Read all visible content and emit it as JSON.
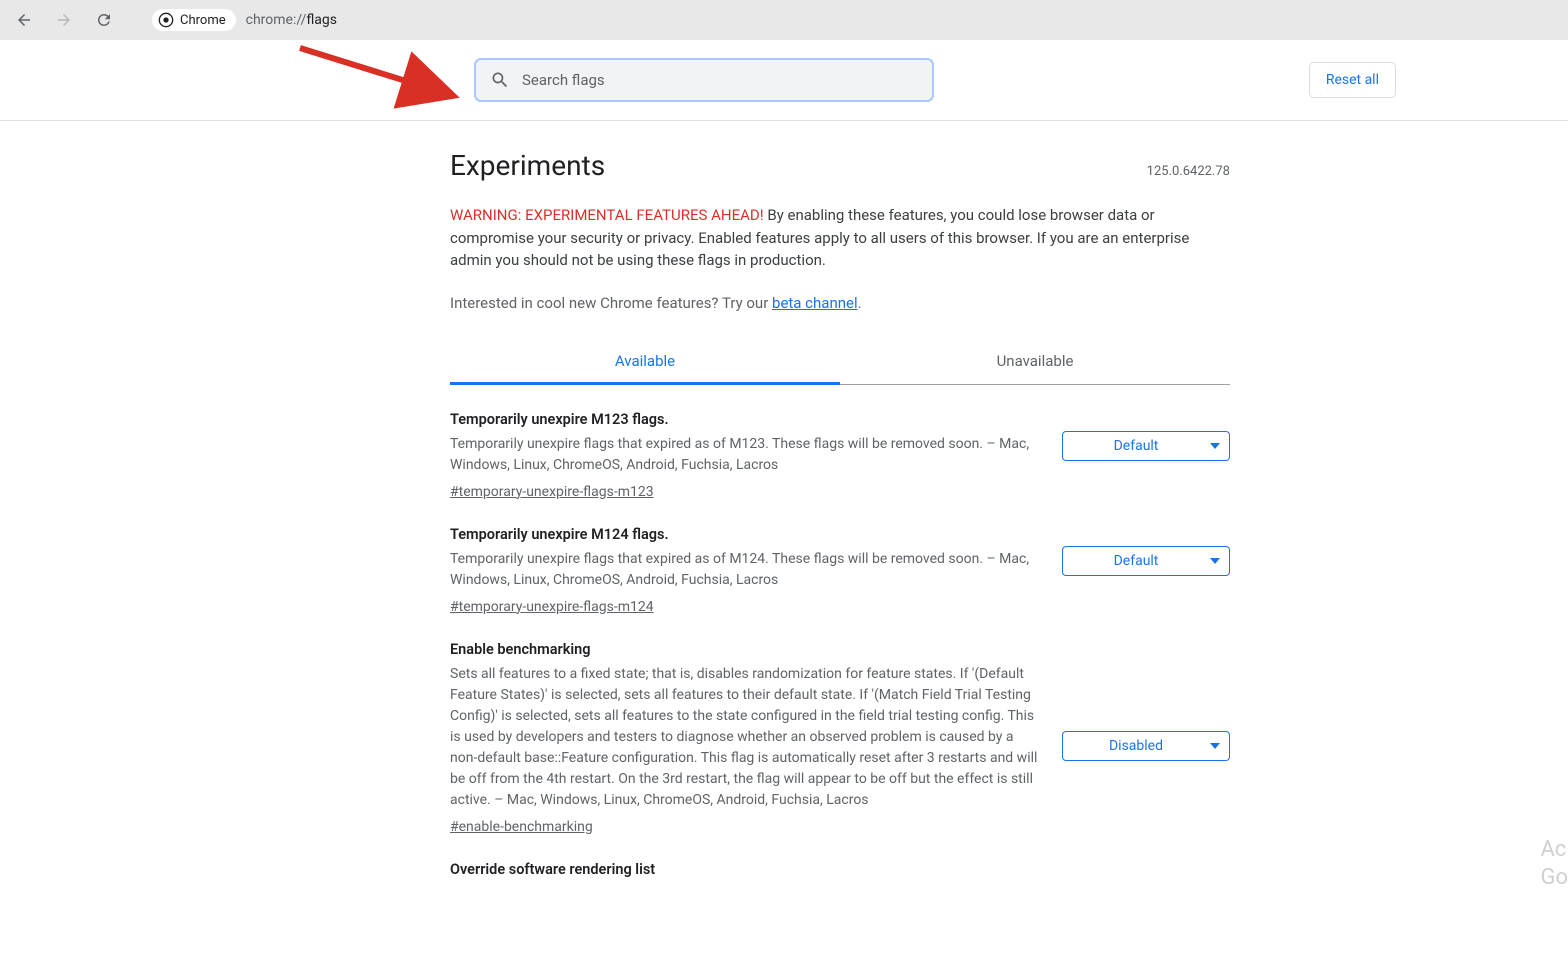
{
  "browser": {
    "chrome_label": "Chrome",
    "url_prefix": "chrome://",
    "url_path": "flags"
  },
  "search": {
    "placeholder": "Search flags"
  },
  "reset_label": "Reset all",
  "title": "Experiments",
  "version": "125.0.6422.78",
  "warning_prefix": "WARNING: EXPERIMENTAL FEATURES AHEAD!",
  "warning_body": " By enabling these features, you could lose browser data or compromise your security or privacy. Enabled features apply to all users of this browser. If you are an enterprise admin you should not be using these flags in production.",
  "interest_prefix": "Interested in cool new Chrome features? Try our ",
  "interest_link": "beta channel",
  "interest_suffix": ".",
  "tabs": {
    "available": "Available",
    "unavailable": "Unavailable"
  },
  "flags": [
    {
      "title": "Temporarily unexpire M123 flags.",
      "desc": "Temporarily unexpire flags that expired as of M123. These flags will be removed soon. – Mac, Windows, Linux, ChromeOS, Android, Fuchsia, Lacros",
      "anchor": "#temporary-unexpire-flags-m123",
      "value": "Default"
    },
    {
      "title": "Temporarily unexpire M124 flags.",
      "desc": "Temporarily unexpire flags that expired as of M124. These flags will be removed soon. – Mac, Windows, Linux, ChromeOS, Android, Fuchsia, Lacros",
      "anchor": "#temporary-unexpire-flags-m124",
      "value": "Default"
    },
    {
      "title": "Enable benchmarking",
      "desc": "Sets all features to a fixed state; that is, disables randomization for feature states. If '(Default Feature States)' is selected, sets all features to their default state. If '(Match Field Trial Testing Config)' is selected, sets all features to the state configured in the field trial testing config. This is used by developers and testers to diagnose whether an observed problem is caused by a non-default base::Feature configuration. This flag is automatically reset after 3 restarts and will be off from the 4th restart. On the 3rd restart, the flag will appear to be off but the effect is still active. – Mac, Windows, Linux, ChromeOS, Android, Fuchsia, Lacros",
      "anchor": "#enable-benchmarking",
      "value": "Disabled"
    },
    {
      "title": "Override software rendering list",
      "desc": "",
      "anchor": "",
      "value": ""
    }
  ],
  "watermark": {
    "line1": "Ac",
    "line2": "Go"
  }
}
